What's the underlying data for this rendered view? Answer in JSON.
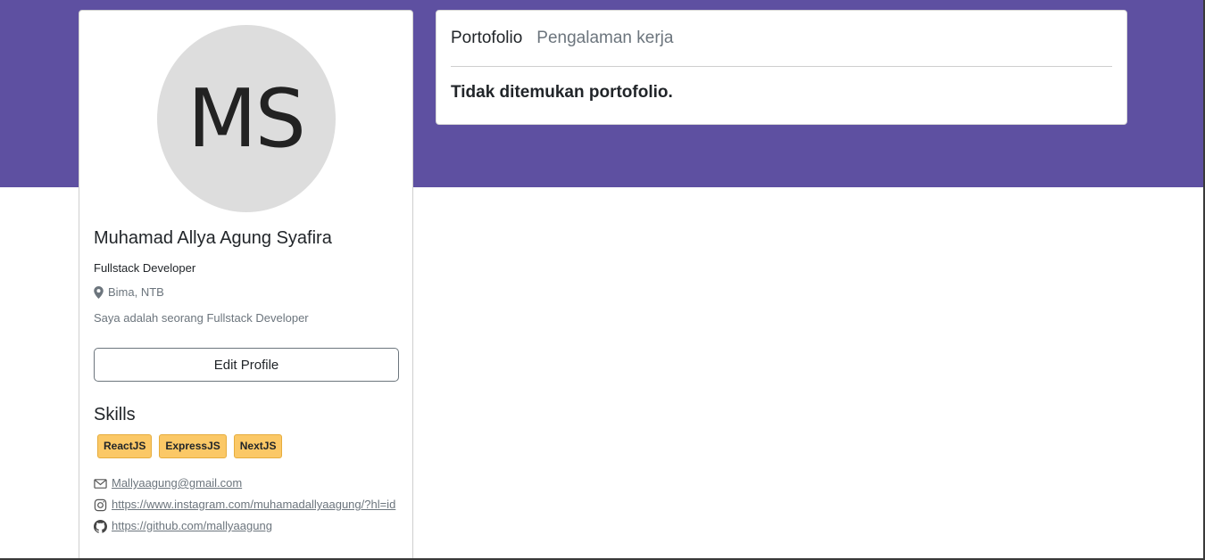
{
  "profile": {
    "initials": "MS",
    "name": "Muhamad Allya Agung Syafira",
    "job": "Fullstack Developer",
    "location": "Bima, NTB",
    "bio": "Saya adalah seorang Fullstack Developer",
    "edit_label": "Edit Profile",
    "skills_title": "Skills",
    "skills": [
      "ReactJS",
      "ExpressJS",
      "NextJS"
    ],
    "email": "Mallyaagung@gmail.com",
    "instagram": "https://www.instagram.com/muhamadallyaagung/?hl=id",
    "github": "https://github.com/mallyaagung"
  },
  "tabs": {
    "portfolio_label": "Portofolio",
    "experience_label": "Pengalaman kerja"
  },
  "content": {
    "empty_message": "Tidak ditemukan portofolio."
  },
  "colors": {
    "hero": "#5e50a1",
    "skill_badge": "#fbc866",
    "avatar_bg": "#dddddd"
  },
  "icons": {
    "location": "map-pin-icon",
    "email": "envelope-icon",
    "instagram": "instagram-icon",
    "github": "github-icon"
  }
}
